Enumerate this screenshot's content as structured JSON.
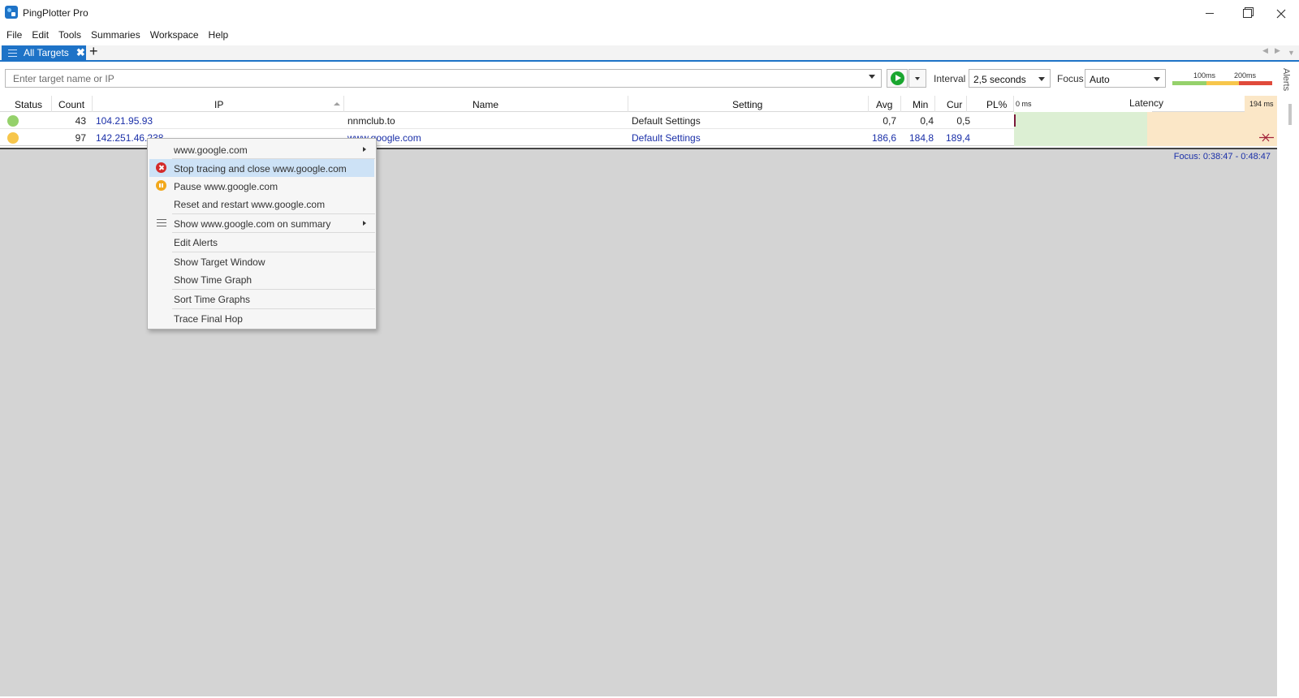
{
  "window": {
    "title": "PingPlotter Pro"
  },
  "menu": [
    "File",
    "Edit",
    "Tools",
    "Summaries",
    "Workspace",
    "Help"
  ],
  "tabs": {
    "active_label": "All Targets",
    "close_glyph": "✖",
    "add_glyph": "+"
  },
  "toolbar": {
    "target_placeholder": "Enter target name or IP",
    "interval_label": "Interval",
    "interval_value": "2,5 seconds",
    "focus_label": "Focus",
    "focus_value": "Auto",
    "scale_100": "100ms",
    "scale_200": "200ms",
    "alerts_side": "Alerts"
  },
  "colors": {
    "accent": "#1e73c7",
    "good": "#95d16b",
    "warn": "#f7c64b",
    "bad": "#e04a3b",
    "link_text": "#1a2fa8",
    "latency_good_bg": "#dcefd3",
    "latency_warn_bg": "#fbe7c7"
  },
  "table": {
    "columns": {
      "status": "Status",
      "count": "Count",
      "ip": "IP",
      "name": "Name",
      "setting": "Setting",
      "avg": "Avg",
      "min": "Min",
      "cur": "Cur",
      "pl": "PL%",
      "latency": "Latency",
      "latency_min": "0 ms",
      "latency_max": "194 ms"
    },
    "rows": [
      {
        "status": "good",
        "count": "43",
        "ip": "104.21.95.93",
        "name": "nnmclub.to",
        "setting": "Default Settings",
        "avg": "0,7",
        "min": "0,4",
        "cur": "0,5",
        "pl": ""
      },
      {
        "status": "warn",
        "count": "97",
        "ip": "142.251.46.238",
        "name": "www.google.com",
        "setting": "Default Settings",
        "avg": "186,6",
        "min": "184,8",
        "cur": "189,4",
        "pl": ""
      }
    ]
  },
  "focus_range": "Focus: 0:38:47 - 0:48:47",
  "context_menu": {
    "items": [
      {
        "label": "www.google.com",
        "submenu": true
      },
      {
        "label": "Stop tracing and close www.google.com",
        "icon": "stop-icon",
        "highlighted": true
      },
      {
        "label": "Pause www.google.com",
        "icon": "pause-icon"
      },
      {
        "label": "Reset and restart www.google.com"
      },
      {
        "label": "Show www.google.com on summary",
        "icon": "list-icon",
        "submenu": true
      },
      {
        "label": "Edit Alerts"
      },
      {
        "label": "Show Target Window"
      },
      {
        "label": "Show Time Graph"
      },
      {
        "label": "Sort Time Graphs"
      },
      {
        "label": "Trace Final Hop"
      }
    ]
  }
}
